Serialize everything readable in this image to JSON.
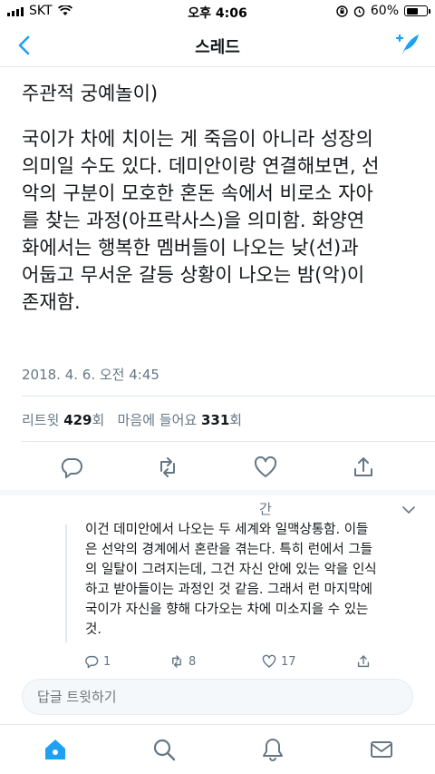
{
  "status_bar": {
    "carrier": "SKT",
    "time": "오후 4:06",
    "battery": "60%",
    "battery_level": 0.6
  },
  "nav": {
    "title": "스레드",
    "back_icon": "chevron-left-icon",
    "compose_icon": "compose-tweet-icon"
  },
  "tweet": {
    "title": "주관적 궁예놀이)",
    "body": "국이가 차에 치이는 게 죽음이 아니라 성장의\n의미일 수도 있다. 데미안이랑 연결해보면, 선\n악의 구분이 모호한 혼돈 속에서 비로소 자아\n를 찾는 과정(아프락사스)을 의미함. 화양연\n화에서는 행복한 멤버들이 나오는 낮(선)과\n어둡고 무서운 갈등 상황이 나오는 밤(악)이\n존재함.",
    "timestamp": "2018. 4. 6. 오전 4:45",
    "retweets_label": "리트윗",
    "retweets_count": "429",
    "retweets_unit": "회",
    "likes_label": "마음에 들어요",
    "likes_count": "331",
    "likes_unit": "회"
  },
  "reply": {
    "name_fragment": "간",
    "text": "이건 데미안에서 나오는 두 세계와 일맥상통함. 이들\n은 선악의 경계에서 혼란을 겪는다. 특히 런에서 그들\n의 일탈이 그려지는데, 그건 자신 안에 있는 악을 인식\n하고 받아들이는 과정인 것 같음. 그래서 런 마지막에\n국이가 자신을 향해 다가오는 차에 미소지을 수 있는\n것.",
    "replies": "1",
    "retweets": "8",
    "likes": "17"
  },
  "reply_input": {
    "placeholder": "답글 트윗하기"
  },
  "colors": {
    "accent": "#1da1f2",
    "text": "#14171a",
    "secondary": "#657786",
    "divider": "#e1e8ed"
  }
}
